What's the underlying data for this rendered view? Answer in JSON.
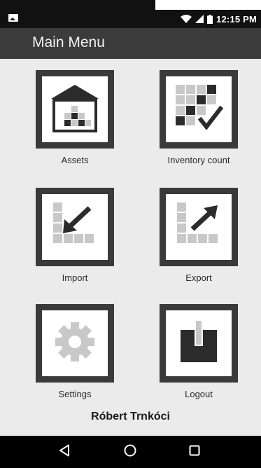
{
  "status_bar": {
    "time": "12:15 PM",
    "icons": [
      "image-notification-icon",
      "wifi-icon",
      "signal-icon",
      "battery-icon"
    ]
  },
  "app_bar": {
    "title": "Main Menu"
  },
  "menu": {
    "items": [
      {
        "label": "Assets",
        "icon": "assets-house-icon"
      },
      {
        "label": "Inventory count",
        "icon": "inventory-check-icon"
      },
      {
        "label": "Import",
        "icon": "import-arrow-icon"
      },
      {
        "label": "Export",
        "icon": "export-arrow-icon"
      },
      {
        "label": "Settings",
        "icon": "gear-icon"
      },
      {
        "label": "Logout",
        "icon": "logout-door-icon"
      }
    ]
  },
  "user": {
    "name": "Róbert Trnkóci"
  },
  "nav_bar": {
    "buttons": [
      "back-icon",
      "home-icon",
      "recents-icon"
    ]
  },
  "colors": {
    "frame": "#3a3a3a",
    "app_bar": "#3b3b3b",
    "background": "#ebebeb",
    "icon_gray": "#c8c8c8",
    "icon_dark": "#2b2b2b"
  }
}
